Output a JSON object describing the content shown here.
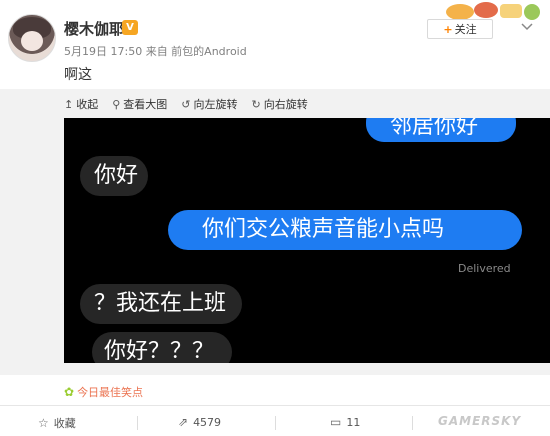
{
  "header": {
    "username": "樱木伽耶",
    "vip_badge": "V",
    "meta": "5月19日 17:50 来自 前包的Android",
    "follow_label": "关注",
    "follow_icon": "+",
    "more_icon": "chevron-down-icon"
  },
  "post": {
    "text": "啊这"
  },
  "image_toolbar": {
    "items": [
      {
        "icon": "↥",
        "label": "收起"
      },
      {
        "icon": "⚲",
        "label": "查看大图"
      },
      {
        "icon": "↺",
        "label": "向左旋转"
      },
      {
        "icon": "↻",
        "label": "向右旋转"
      }
    ]
  },
  "photo": {
    "bubbles": [
      {
        "text": "邻居你好",
        "side": "right",
        "color": "blue"
      },
      {
        "text": "你好",
        "side": "left",
        "color": "gray"
      },
      {
        "text": "你们交公粮声音能小点吗",
        "side": "right",
        "color": "blue"
      },
      {
        "text": "？我还在上班",
        "side": "left",
        "color": "gray"
      },
      {
        "text": "你好？？？",
        "side": "left",
        "color": "gray"
      }
    ],
    "delivered": "Delivered"
  },
  "topic": {
    "icon": "✿",
    "label": "今日最佳笑点"
  },
  "actions": {
    "favorite": {
      "icon": "☆",
      "label": "收藏"
    },
    "repost": {
      "icon": "⇗",
      "label": "4579"
    },
    "comment": {
      "icon": "▭",
      "label": "11"
    }
  },
  "watermark": "GAMERSKY",
  "colors": {
    "accent": "#ff8200",
    "bubble_blue": "#1e7cf2",
    "bubble_gray": "#262626",
    "topic": "#eb7350"
  }
}
